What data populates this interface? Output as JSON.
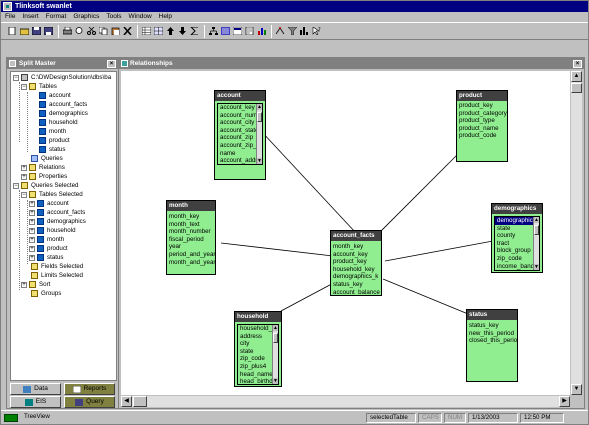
{
  "window": {
    "title": "Tlinksoft swanlet"
  },
  "menu": [
    "File",
    "Insert",
    "Format",
    "Graphics",
    "Tools",
    "Window",
    "Help"
  ],
  "split_master": {
    "title": "Split Master",
    "root": "C:\\DWDesignSolution\\dbs\\ba",
    "tables_label": "Tables",
    "tables": [
      "account",
      "account_facts",
      "demographics",
      "household",
      "month",
      "product",
      "status"
    ],
    "queries_label": "Queries",
    "relations_label": "Relations",
    "properties_label": "Properties",
    "queries_selected_label": "Queries Selected",
    "tables_selected_label": "Tables Selected",
    "selected_tables": [
      "account",
      "account_facts",
      "demographics",
      "household",
      "month",
      "product",
      "status"
    ],
    "fields_selected_label": "Fields Selected",
    "limits_selected_label": "Limits Selected",
    "sort_label": "Sort",
    "groups_label": "Groups",
    "tabs": {
      "data": "Data",
      "reports": "Reports",
      "eis": "EIS",
      "query": "Query"
    }
  },
  "relationships": {
    "title": "Relationships",
    "tables": {
      "account": {
        "name": "account",
        "fields": [
          "account_key",
          "account_num",
          "account_city",
          "account_state",
          "account_zip",
          "account_zip_c",
          "name",
          "account_addr"
        ]
      },
      "product": {
        "name": "product",
        "fields": [
          "product_key",
          "product_category",
          "product_type",
          "product_name",
          "product_code"
        ]
      },
      "month": {
        "name": "month",
        "fields": [
          "month_key",
          "month_text",
          "month_number",
          "fiscal_period",
          "year",
          "period_and_year",
          "month_and_year"
        ]
      },
      "account_facts": {
        "name": "account_facts",
        "fields": [
          "month_key",
          "account_key",
          "product_key",
          "household_key",
          "demographics_k",
          "status_key",
          "account_balance"
        ]
      },
      "demographics": {
        "name": "demographics",
        "fields": [
          "demographics",
          "state",
          "county",
          "tract",
          "block_group",
          "zip_code",
          "income_band"
        ]
      },
      "household": {
        "name": "household",
        "fields": [
          "household_ke",
          "address",
          "city",
          "state",
          "zip_code",
          "zip_plus4",
          "head_name",
          "head_birthdat"
        ]
      },
      "status": {
        "name": "status",
        "fields": [
          "status_key",
          "new_this_period",
          "closed_this_perio"
        ]
      }
    }
  },
  "status_bar": {
    "left": "TreeView",
    "selection": "selectedTable",
    "caps": "CAPS",
    "num": "NUM",
    "date": "1/13/2003",
    "time": "12:50 PM"
  },
  "colors": {
    "table_fill": "#90ee90",
    "title_bar": "#000080",
    "table_header": "#404040"
  }
}
